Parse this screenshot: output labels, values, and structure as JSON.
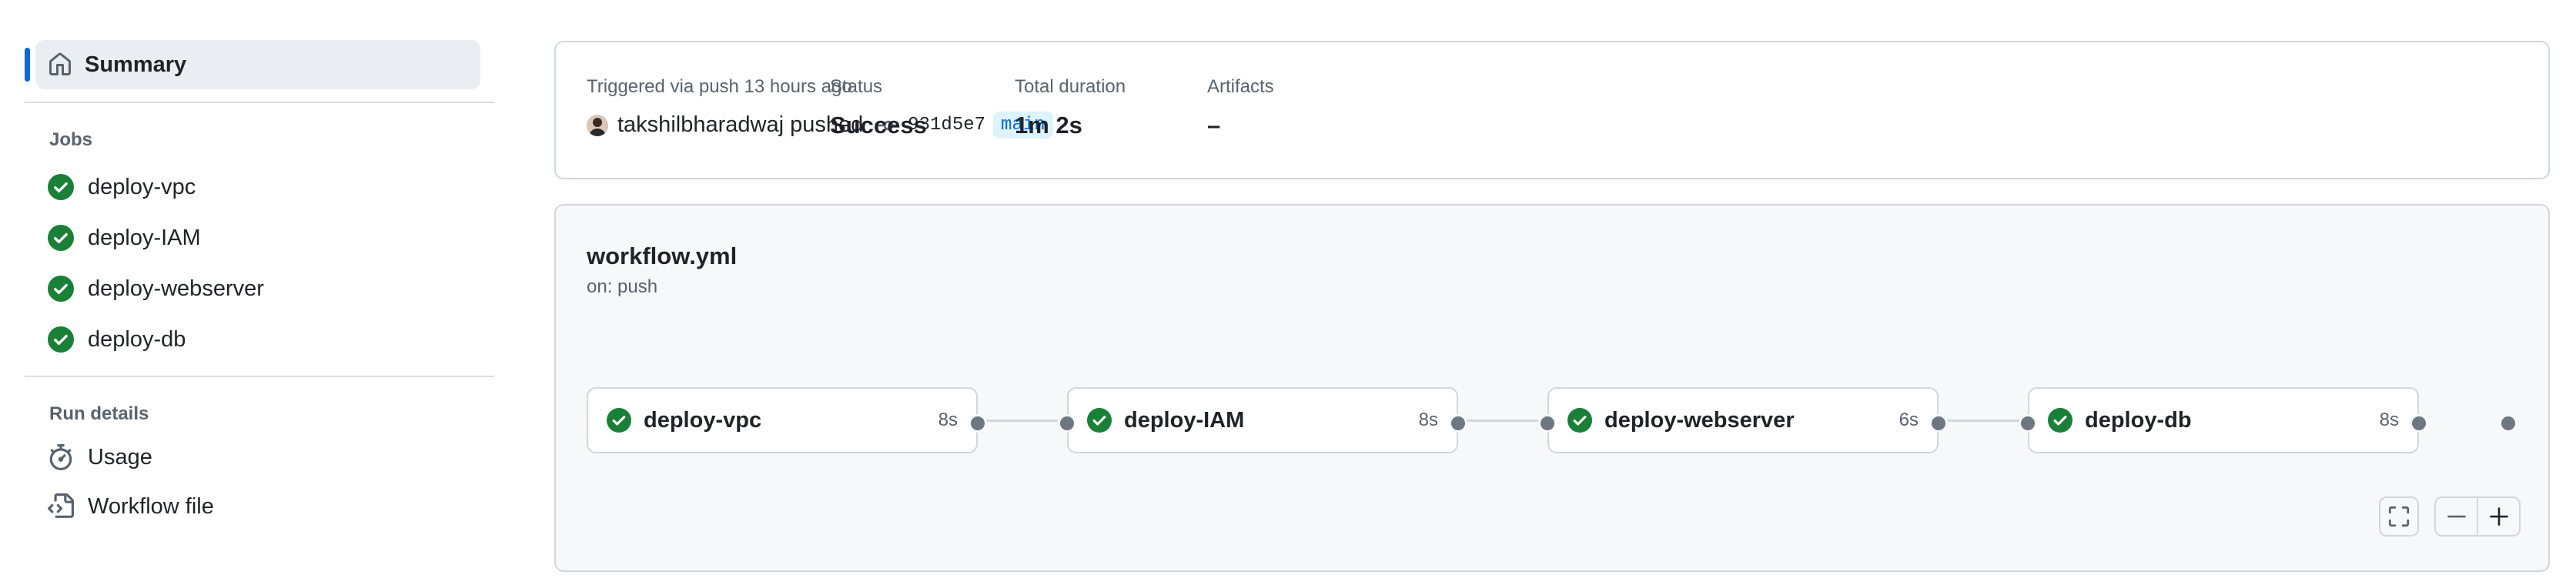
{
  "sidebar": {
    "summary_label": "Summary",
    "jobs_title": "Jobs",
    "jobs": [
      {
        "label": "deploy-vpc",
        "status": "success"
      },
      {
        "label": "deploy-IAM",
        "status": "success"
      },
      {
        "label": "deploy-webserver",
        "status": "success"
      },
      {
        "label": "deploy-db",
        "status": "success"
      }
    ],
    "run_details_title": "Run details",
    "run_details": [
      {
        "label": "Usage",
        "icon": "stopwatch-icon"
      },
      {
        "label": "Workflow file",
        "icon": "file-code-icon"
      }
    ]
  },
  "summary": {
    "trigger_text": "Triggered via push 13 hours ago",
    "actor": "takshilbharadwaj pushed",
    "commit_sha": "931d5e7",
    "branch": "main",
    "status_label": "Status",
    "status_value": "Success",
    "duration_label": "Total duration",
    "duration_value": "1m 2s",
    "artifacts_label": "Artifacts",
    "artifacts_value": "–"
  },
  "workflow": {
    "name": "workflow.yml",
    "trigger": "on: push",
    "jobs": [
      {
        "name": "deploy-vpc",
        "duration": "8s",
        "status": "success"
      },
      {
        "name": "deploy-IAM",
        "duration": "8s",
        "status": "success"
      },
      {
        "name": "deploy-webserver",
        "duration": "6s",
        "status": "success"
      },
      {
        "name": "deploy-db",
        "duration": "8s",
        "status": "success"
      }
    ]
  },
  "colors": {
    "success": "#1a7f37",
    "accent": "#0969da",
    "border": "#d0d7de"
  }
}
